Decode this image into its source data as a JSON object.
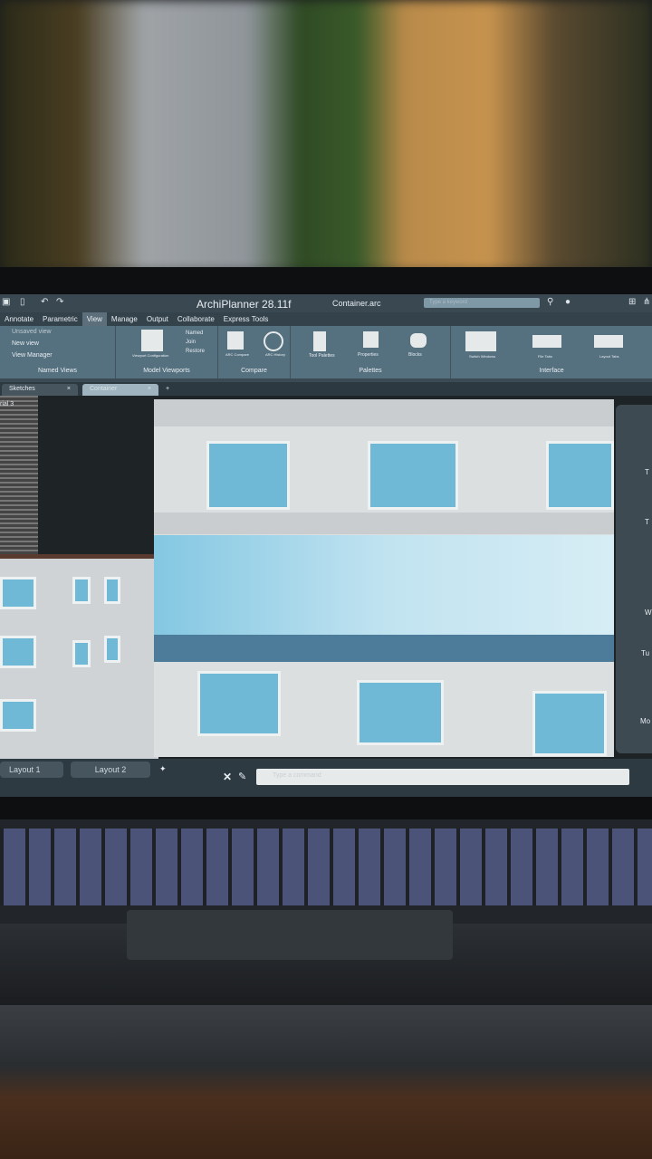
{
  "app": {
    "title": "ArchiPlanner 28.11f",
    "file": "Container.arc",
    "search_placeholder": "Type a keyword"
  },
  "menu": [
    "Annotate",
    "Parametric",
    "View",
    "Manage",
    "Output",
    "Collaborate",
    "Express Tools"
  ],
  "menu_active": "View",
  "ribbon": {
    "named_views": {
      "label": "Named Views",
      "items": [
        "Unsaved view",
        "New view",
        "View Manager"
      ]
    },
    "model_viewports": {
      "label": "Model Viewports",
      "config": "Viewport Configuration",
      "items": [
        "Named",
        "Join",
        "Restore"
      ]
    },
    "compare": {
      "label": "Compare",
      "items": [
        "ARC Compare",
        "ARC History"
      ]
    },
    "palettes": {
      "label": "Palettes",
      "items": [
        "Tool Palettes",
        "Properties",
        "Blocks"
      ]
    },
    "interface": {
      "label": "Interface",
      "items": [
        "Switch Windows",
        "File Tabs",
        "Layout Tabs"
      ]
    }
  },
  "doc_tabs": [
    "Sketches",
    "Container"
  ],
  "viewport_label": "rial 3",
  "panel_letters": [
    "T",
    "T",
    "W",
    "Tu",
    "Mo"
  ],
  "layout_tabs": [
    "Layout 1",
    "Layout 2"
  ],
  "command_placeholder": "Type a command",
  "icons": [
    "print-icon",
    "phone-icon",
    "undo-icon",
    "redo-icon",
    "search-icon",
    "user-icon",
    "cart-icon",
    "share-icon",
    "close-icon",
    "pencil-icon",
    "pin-icon"
  ]
}
